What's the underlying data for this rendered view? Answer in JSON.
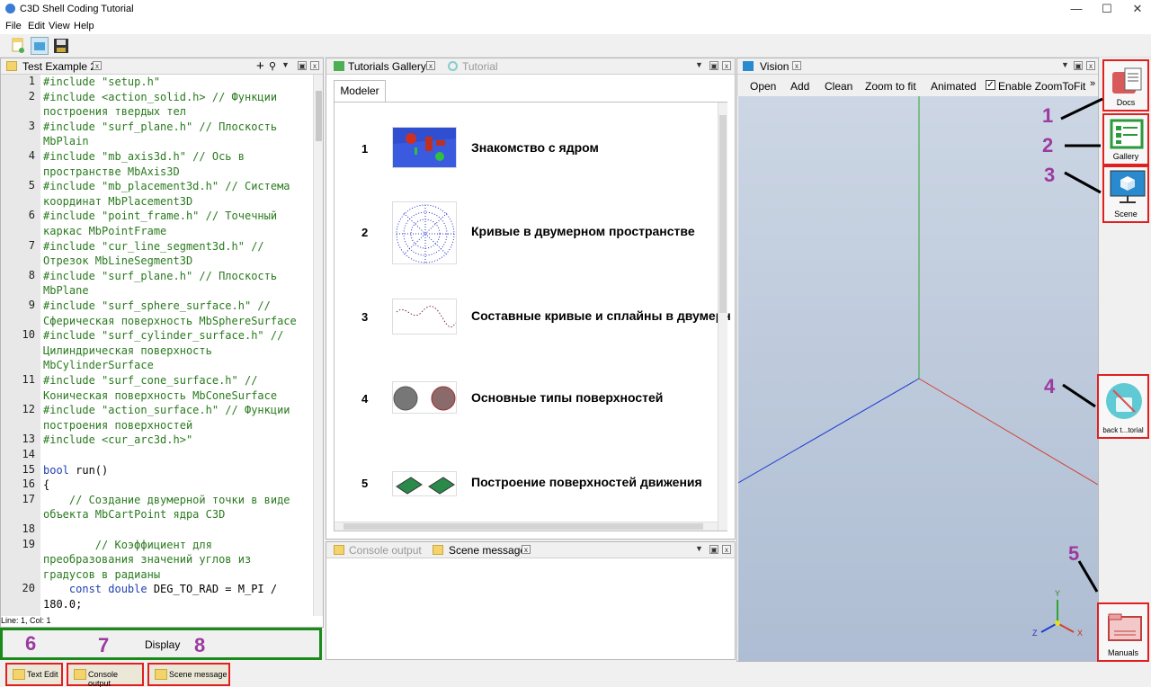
{
  "window": {
    "title": "C3D Shell Coding Tutorial"
  },
  "menu": [
    "File",
    "Edit",
    "View",
    "Help"
  ],
  "editor": {
    "tab_label": "Test Example 2",
    "status": "Line: 1, Col: 1",
    "lines": [
      {
        "n": "1",
        "parts": [
          {
            "t": "#include \"setup.h\"",
            "c": "g"
          }
        ]
      },
      {
        "n": "2",
        "parts": [
          {
            "t": "#include <action_solid.h> // Функции",
            "c": "g"
          }
        ]
      },
      {
        "n": "",
        "parts": [
          {
            "t": "построения твердых тел",
            "c": "g"
          }
        ]
      },
      {
        "n": "3",
        "parts": [
          {
            "t": "#include \"surf_plane.h\" // Плоскость",
            "c": "g"
          }
        ]
      },
      {
        "n": "",
        "parts": [
          {
            "t": "MbPlain",
            "c": "g"
          }
        ]
      },
      {
        "n": "4",
        "parts": [
          {
            "t": "#include \"mb_axis3d.h\" // Ось в",
            "c": "g"
          }
        ]
      },
      {
        "n": "",
        "parts": [
          {
            "t": "пространстве MbAxis3D",
            "c": "g"
          }
        ]
      },
      {
        "n": "5",
        "parts": [
          {
            "t": "#include \"mb_placement3d.h\" // Система",
            "c": "g"
          }
        ]
      },
      {
        "n": "",
        "parts": [
          {
            "t": "координат MbPlacement3D",
            "c": "g"
          }
        ]
      },
      {
        "n": "6",
        "parts": [
          {
            "t": "#include \"point_frame.h\" // Точечный",
            "c": "g"
          }
        ]
      },
      {
        "n": "",
        "parts": [
          {
            "t": "каркас MbPointFrame",
            "c": "g"
          }
        ]
      },
      {
        "n": "7",
        "parts": [
          {
            "t": "#include \"cur_line_segment3d.h\" //",
            "c": "g"
          }
        ]
      },
      {
        "n": "",
        "parts": [
          {
            "t": "Отрезок MbLineSegment3D",
            "c": "g"
          }
        ]
      },
      {
        "n": "8",
        "parts": [
          {
            "t": "#include \"surf_plane.h\" // Плоскость",
            "c": "g"
          }
        ]
      },
      {
        "n": "",
        "parts": [
          {
            "t": "MbPlane",
            "c": "g"
          }
        ]
      },
      {
        "n": "9",
        "parts": [
          {
            "t": "#include \"surf_sphere_surface.h\" //",
            "c": "g"
          }
        ]
      },
      {
        "n": "",
        "parts": [
          {
            "t": "Сферическая поверхность MbSphereSurface",
            "c": "g"
          }
        ]
      },
      {
        "n": "10",
        "parts": [
          {
            "t": "#include \"surf_cylinder_surface.h\" //",
            "c": "g"
          }
        ]
      },
      {
        "n": "",
        "parts": [
          {
            "t": "Цилиндрическая поверхность",
            "c": "g"
          }
        ]
      },
      {
        "n": "",
        "parts": [
          {
            "t": "MbCylinderSurface",
            "c": "g"
          }
        ]
      },
      {
        "n": "11",
        "parts": [
          {
            "t": "#include \"surf_cone_surface.h\" //",
            "c": "g"
          }
        ]
      },
      {
        "n": "",
        "parts": [
          {
            "t": "Коническая поверхность MbConeSurface",
            "c": "g"
          }
        ]
      },
      {
        "n": "12",
        "parts": [
          {
            "t": "#include \"action_surface.h\" // Функции",
            "c": "g"
          }
        ]
      },
      {
        "n": "",
        "parts": [
          {
            "t": "построения поверхностей",
            "c": "g"
          }
        ]
      },
      {
        "n": "13",
        "parts": [
          {
            "t": "#include <cur_arc3d.h>\"",
            "c": "g"
          }
        ]
      },
      {
        "n": "14",
        "parts": [
          {
            "t": "",
            "c": "p"
          }
        ]
      },
      {
        "n": "15",
        "parts": [
          {
            "t": "bool",
            "c": "k"
          },
          {
            "t": " run()",
            "c": "p"
          }
        ]
      },
      {
        "n": "16",
        "parts": [
          {
            "t": "{",
            "c": "p"
          }
        ]
      },
      {
        "n": "17",
        "parts": [
          {
            "t": "    // Создание двумерной точки в виде",
            "c": "g"
          }
        ]
      },
      {
        "n": "",
        "parts": [
          {
            "t": "объекта MbCartPoint ядра C3D",
            "c": "g"
          }
        ]
      },
      {
        "n": "18",
        "parts": [
          {
            "t": "",
            "c": "p"
          }
        ]
      },
      {
        "n": "19",
        "parts": [
          {
            "t": "        // Коэффициент для",
            "c": "g"
          }
        ]
      },
      {
        "n": "",
        "parts": [
          {
            "t": "преобразования значений углов из",
            "c": "g"
          }
        ]
      },
      {
        "n": "",
        "parts": [
          {
            "t": "градусов в радианы",
            "c": "g"
          }
        ]
      },
      {
        "n": "20",
        "parts": [
          {
            "t": "    const double",
            "c": "k"
          },
          {
            "t": " DEG_TO_RAD = M_PI /",
            "c": "p"
          }
        ]
      },
      {
        "n": "",
        "parts": [
          {
            "t": "180.0;",
            "c": "p"
          }
        ]
      }
    ]
  },
  "display_bar": {
    "label": "Display"
  },
  "gallery": {
    "tab_label": "Tutorials Gallery",
    "tab2_label": "Tutorial",
    "subtab": "Modeler",
    "items": [
      {
        "num": "1",
        "title": "Знакомство с ядром"
      },
      {
        "num": "2",
        "title": "Кривые в двумерном пространстве"
      },
      {
        "num": "3",
        "title": "Составные кривые и сплайны в двумерн"
      },
      {
        "num": "4",
        "title": "Основные типы поверхностей"
      },
      {
        "num": "5",
        "title": "Построение поверхностей движения"
      }
    ]
  },
  "console": {
    "tab1": "Console output",
    "tab2": "Scene message"
  },
  "vision": {
    "tab_label": "Vision",
    "buttons": [
      "Open",
      "Add",
      "Clean",
      "Zoom to fit",
      "Animated"
    ],
    "checkbox_label": "Enable ZoomToFit",
    "checkbox_checked": true,
    "more": "»",
    "axes": {
      "x": "X",
      "y": "Y",
      "z": "Z"
    }
  },
  "right_bar": {
    "docs": "Docs",
    "gallery": "Gallery",
    "scene": "Scene",
    "back": "back t...torial",
    "manuals": "Manuals"
  },
  "annotations": [
    "1",
    "2",
    "3",
    "4",
    "5",
    "6",
    "7",
    "8"
  ],
  "bottom_tabs": [
    "Text Edit",
    "Console output",
    "Scene message"
  ],
  "colors": {
    "highlight_red": "#e02020",
    "highlight_green": "#1a8a1a",
    "annotation_purple": "#9b3aa0",
    "code_green": "#2a7a1f",
    "keyword_blue": "#1f3fb0"
  }
}
